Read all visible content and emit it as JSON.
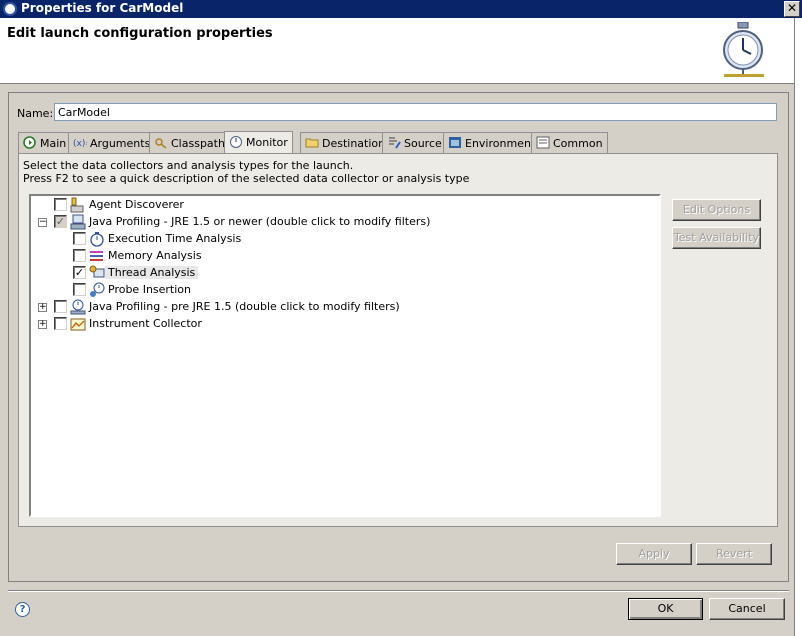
{
  "window": {
    "title": "Properties for CarModel"
  },
  "header": {
    "title": "Edit launch configuration properties"
  },
  "name": {
    "label": "Name:",
    "value": "CarModel"
  },
  "tabs": [
    {
      "label": "Main",
      "icon": "run-icon"
    },
    {
      "label": "Arguments",
      "icon": "arguments-icon"
    },
    {
      "label": "Classpath",
      "icon": "classpath-icon"
    },
    {
      "label": "Monitor",
      "icon": "monitor-icon",
      "active": true
    },
    {
      "label": "Destination",
      "icon": "folder-icon"
    },
    {
      "label": "Source",
      "icon": "source-icon"
    },
    {
      "label": "Environment",
      "icon": "environment-icon"
    },
    {
      "label": "Common",
      "icon": "common-icon"
    }
  ],
  "monitor": {
    "description1": "Select the data collectors and analysis types for the launch.",
    "description2": "Press F2 to see a quick description of the selected data collector or analysis type",
    "tree": [
      {
        "label": "Agent Discoverer",
        "checked": false,
        "expander": ""
      },
      {
        "label": "Java Profiling - JRE 1.5 or newer (double click to modify filters)",
        "checked": true,
        "grayed": true,
        "expander": "−"
      },
      {
        "label": "Execution Time Analysis",
        "checked": false
      },
      {
        "label": "Memory Analysis",
        "checked": false
      },
      {
        "label": "Thread Analysis",
        "checked": true,
        "selected": true
      },
      {
        "label": "Probe Insertion",
        "checked": false
      },
      {
        "label": "Java Profiling - pre JRE 1.5 (double click to modify filters)",
        "checked": false,
        "expander": "+"
      },
      {
        "label": "Instrument Collector",
        "checked": false,
        "expander": "+"
      }
    ],
    "edit_options": "Edit Options",
    "test_availability": "Test Availability"
  },
  "buttons": {
    "apply": "Apply",
    "revert": "Revert",
    "ok": "OK",
    "cancel": "Cancel"
  },
  "colors": {
    "titlebar": "#0a246a",
    "dialog": "#d4d0c8"
  }
}
